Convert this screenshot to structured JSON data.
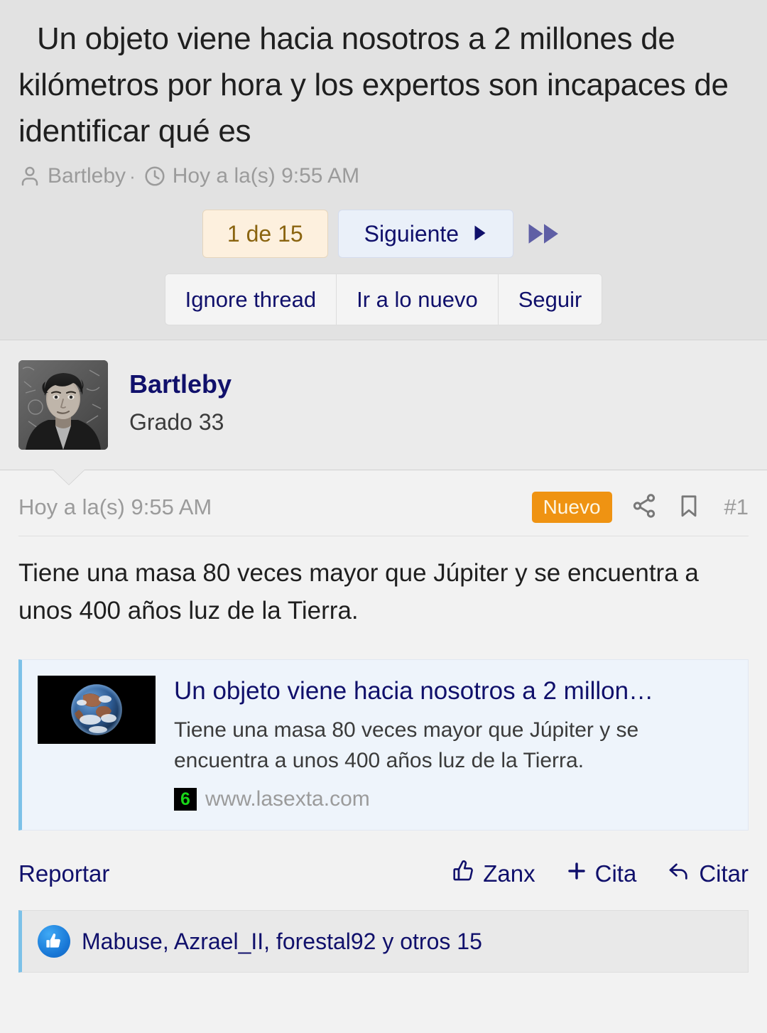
{
  "thread": {
    "title": "Un objeto viene hacia nosotros a 2 millones de kilómetros por hora y los expertos son incapaces de identificar qué es",
    "author": "Bartleby",
    "separator": "·",
    "timestamp": "Hoy a la(s) 9:55 AM",
    "author_icon": "person-icon",
    "time_icon": "clock-icon"
  },
  "nav": {
    "page_indicator": "1 de 15",
    "next_label": "Siguiente",
    "next_arrow": "▶",
    "fast_forward_icon": "fast-forward-icon",
    "buttons": [
      {
        "label": "Ignore thread",
        "name": "ignore-thread-button"
      },
      {
        "label": "Ir a lo nuevo",
        "name": "go-to-new-button"
      },
      {
        "label": "Seguir",
        "name": "follow-button"
      }
    ]
  },
  "user": {
    "name": "Bartleby",
    "rank": "Grado 33",
    "avatar_icon": "user-avatar-photo"
  },
  "post": {
    "date": "Hoy a la(s) 9:55 AM",
    "badge": "Nuevo",
    "share_icon": "share-icon",
    "bookmark_icon": "bookmark-icon",
    "number": "#1",
    "body": "Tiene una masa 80 veces mayor que Júpiter y se encuentra a unos 400 años luz de la Tierra.",
    "report_label": "Reportar",
    "actions": [
      {
        "label": "Zanx",
        "icon": "thumbs-up-icon",
        "name": "like-button"
      },
      {
        "label": "Cita",
        "icon": "plus-icon",
        "name": "add-quote-button"
      },
      {
        "label": "Citar",
        "icon": "reply-arrow-icon",
        "name": "quote-button"
      }
    ]
  },
  "link_preview": {
    "title": "Un objeto viene hacia nosotros a 2 millon…",
    "description": "Tiene una masa 80 veces mayor que Júpiter y se encuentra a unos 400 años luz de la Tierra.",
    "host": "www.lasexta.com",
    "favicon_glyph": "6",
    "thumbnail_icon": "earth-photo-thumbnail"
  },
  "likes": {
    "icon": "thumbs-up-filled-icon",
    "text": "Mabuse, Azrael_II, forestal92 y otros 15"
  },
  "colors": {
    "accent_link": "#10106b",
    "badge_new": "#ef9312",
    "page_indicator_bg": "#fdf0de",
    "page_indicator_text": "#8a6410",
    "quote_border": "#7cc1e8",
    "favicon_green": "#18d418",
    "fast_forward": "#5f5fa5"
  }
}
